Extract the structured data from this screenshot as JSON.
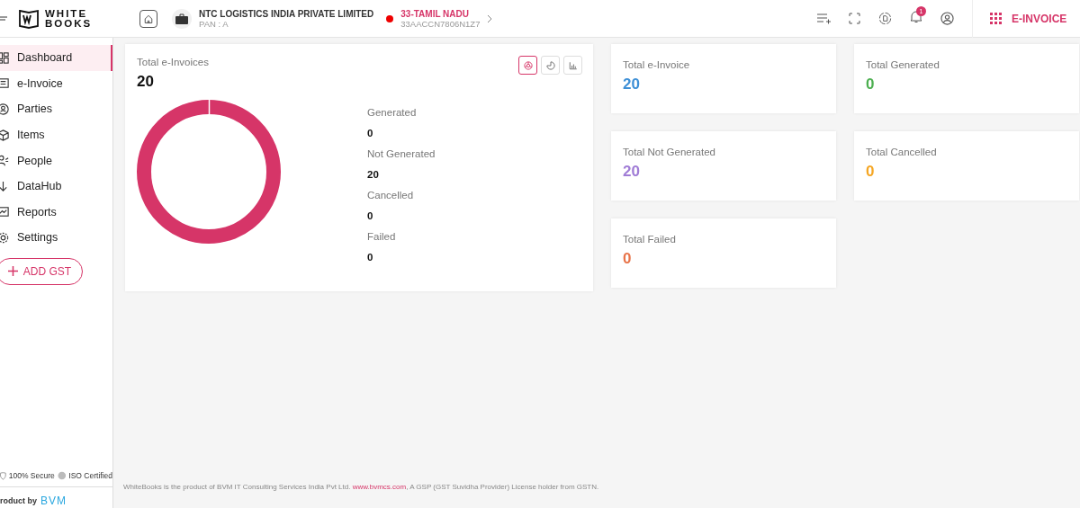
{
  "header": {
    "logo_lines": [
      "WHITE",
      "BOOKS"
    ],
    "company": {
      "name": "NTC LOGISTICS INDIA PRIVATE LIMITED",
      "pan": "PAN : A"
    },
    "state": {
      "name": "33-TAMIL NADU",
      "gstin": "33AACCN7806N1Z7"
    },
    "notification_count": "1",
    "module": "E-INVOICE"
  },
  "sidebar": {
    "items": [
      {
        "label": "Dashboard",
        "selected": true
      },
      {
        "label": "e-Invoice",
        "selected": false
      },
      {
        "label": "Parties",
        "selected": false
      },
      {
        "label": "Items",
        "selected": false
      },
      {
        "label": "People",
        "selected": false
      },
      {
        "label": "DataHub",
        "selected": false
      },
      {
        "label": "Reports",
        "selected": false
      },
      {
        "label": "Settings",
        "selected": false
      }
    ],
    "add_button": "ADD GST",
    "badges": [
      "100% Secure",
      "ISO Certified"
    ],
    "product_by": "roduct by",
    "vendor_logo": "BVM"
  },
  "summary": {
    "title": "Total e-Invoices",
    "total": "20",
    "views": [
      {
        "selected": true
      },
      {
        "selected": false
      },
      {
        "selected": false
      }
    ],
    "legend": [
      {
        "label": "Generated",
        "value": "0"
      },
      {
        "label": "Not Generated",
        "value": "20"
      },
      {
        "label": "Cancelled",
        "value": "0"
      },
      {
        "label": "Failed",
        "value": "0"
      }
    ]
  },
  "stats": [
    {
      "label": "Total e-Invoice",
      "value": "20",
      "color": "#3d8fd6"
    },
    {
      "label": "Total Generated",
      "value": "0",
      "color": "#4caf50"
    },
    {
      "label": "Total Not Generated",
      "value": "20",
      "color": "#a07cd6"
    },
    {
      "label": "Total Cancelled",
      "value": "0",
      "color": "#f5a623"
    },
    {
      "label": "Total Failed",
      "value": "0",
      "color": "#e8744a"
    }
  ],
  "footer": {
    "text": "WhiteBooks is the product of BVM IT Consulting Services India Pvt Ltd. ",
    "link": "www.bvmcs.com",
    "after": ", A GSP (GST Suvidha Provider) License holder from GSTN."
  }
}
